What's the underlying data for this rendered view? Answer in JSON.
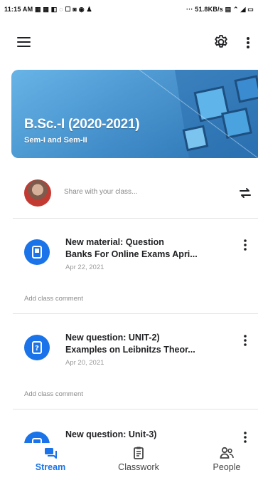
{
  "status_bar": {
    "time": "11:15 AM",
    "left_icons": "▦ ▦ ◧ ◌ ☐ ◙ ◉ ♟",
    "right_text": "··· 51.8KB/s ▤ ⌃ ◢ ▭"
  },
  "app_bar": {
    "menu_icon": "hamburger-menu-icon",
    "settings_icon": "gear-icon",
    "more_icon": "vertical-dots-icon"
  },
  "banner": {
    "title": "B.Sc.-I (2020-2021)",
    "subtitle": "Sem-I and Sem-II",
    "color": "#3b8fd1"
  },
  "share": {
    "placeholder": "Share with your class...",
    "repost_icon": "repost-icon"
  },
  "stream": [
    {
      "type_icon": "material-icon",
      "title_line1": "New material: Question",
      "title_line2": "Banks For Online Exams Apri...",
      "date": "Apr 22, 2021",
      "comment_label": "Add class comment"
    },
    {
      "type_icon": "question-icon",
      "title_line1": "New question: UNIT-2)",
      "title_line2": "Examples on Leibnitzs Theor...",
      "date": "Apr 20, 2021",
      "comment_label": "Add class comment"
    },
    {
      "type_icon": "question-icon",
      "title_line1": "New question: Unit-3)",
      "title_line2": "",
      "date": "",
      "comment_label": ""
    }
  ],
  "bottom_nav": [
    {
      "label": "Stream",
      "active": true
    },
    {
      "label": "Classwork",
      "active": false
    },
    {
      "label": "People",
      "active": false
    }
  ],
  "colors": {
    "accent": "#1a73e8",
    "text": "#202124",
    "muted": "#8a8a8a"
  }
}
